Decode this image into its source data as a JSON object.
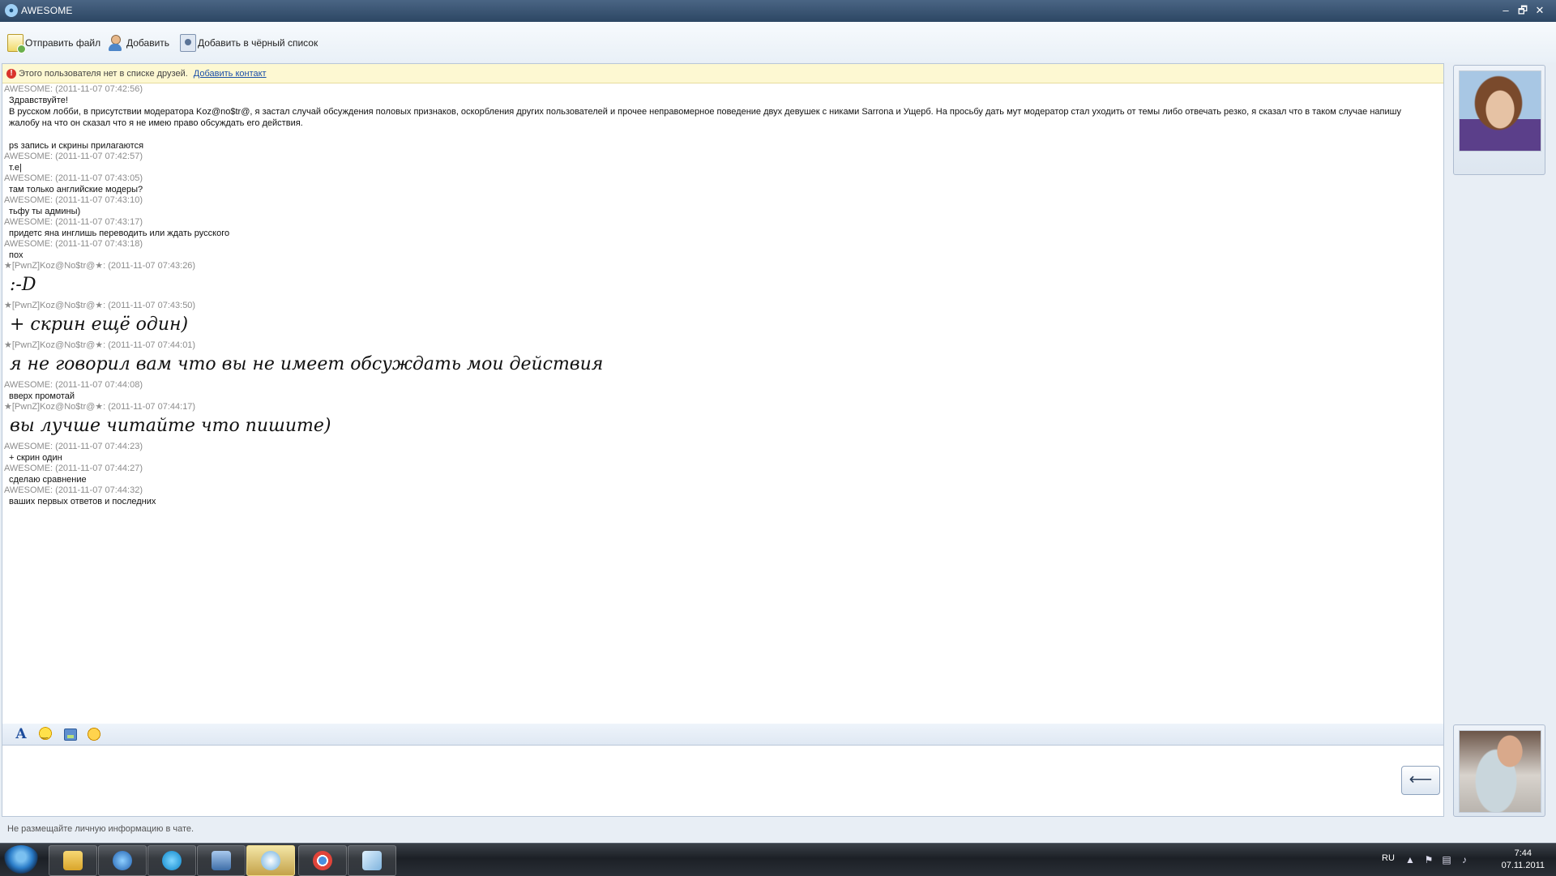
{
  "window": {
    "title": "AWESOME",
    "minimize": "–",
    "maximize": "🗗",
    "close": "✕"
  },
  "toolbar": {
    "send_file": "Отправить файл",
    "add": "Добавить",
    "blacklist": "Добавить в чёрный список"
  },
  "notice": {
    "text": "Этого пользователя нет в списке друзей.",
    "link": "Добавить контакт"
  },
  "messages": [
    {
      "h": "AWESOME: (2011-11-07 07:42:56)",
      "t": "Здравствуйте!\nВ русском лобби, в присутствии модератора Koz@no$tr@, я застал случай обсуждения половых признаков, оскорбления других пользователей и прочее неправомерное поведение двух девушек с никами Sarrona и Ущерб. На просьбу дать мут модератор стал уходить от темы либо отвечать резко, я сказал что в таком случае напишу жалобу на что он сказал что я не имею право обсуждать его действия.\n\nps запись и скрины прилагаются"
    },
    {
      "h": "AWESOME: (2011-11-07 07:42:57)",
      "t": "т.е|"
    },
    {
      "h": "AWESOME: (2011-11-07 07:43:05)",
      "t": "там только английские модеры?"
    },
    {
      "h": "AWESOME: (2011-11-07 07:43:10)",
      "t": "тьфу ты админы)"
    },
    {
      "h": "AWESOME: (2011-11-07 07:43:17)",
      "t": "придетс яна инглишь переводить или ждать русского"
    },
    {
      "h": "AWESOME: (2011-11-07 07:43:18)",
      "t": "пох"
    },
    {
      "h": "★[PwnZ]Koz@No$tr@★: (2011-11-07 07:43:26)",
      "big": ":-D"
    },
    {
      "h": "★[PwnZ]Koz@No$tr@★: (2011-11-07 07:43:50)",
      "big": "+ скрин ещё один)"
    },
    {
      "h": "★[PwnZ]Koz@No$tr@★: (2011-11-07 07:44:01)",
      "big": "я не говорил вам что вы не имеет обсуждать мои действия"
    },
    {
      "h": "AWESOME: (2011-11-07 07:44:08)",
      "t": "вверх промотай"
    },
    {
      "h": "★[PwnZ]Koz@No$tr@★: (2011-11-07 07:44:17)",
      "big": "вы лучше читайте что пишите)"
    },
    {
      "h": "AWESOME: (2011-11-07 07:44:23)",
      "t": "+ скрин один"
    },
    {
      "h": "AWESOME: (2011-11-07 07:44:27)",
      "t": "сделаю сравнение"
    },
    {
      "h": "AWESOME: (2011-11-07 07:44:32)",
      "t": "ваших первых ответов и последних"
    }
  ],
  "input": {
    "send_glyph": "⟵"
  },
  "status_line": "Не размещайте личную информацию в чате.",
  "taskbar": {
    "language": "RU",
    "time": "7:44",
    "date": "07.11.2011"
  },
  "icons": {
    "app": "chat-bubble-icon",
    "send_file": "file-send-icon",
    "add": "add-user-icon",
    "blacklist": "blacklist-icon",
    "font": "font-icon",
    "smile": "smile-icon",
    "image": "image-icon",
    "wink": "wink-icon"
  },
  "colors": {
    "titlebar": "#2c4663",
    "notice_bg": "#fdf8d2",
    "header_text": "#8c8c8c",
    "link": "#1a4fa8"
  }
}
